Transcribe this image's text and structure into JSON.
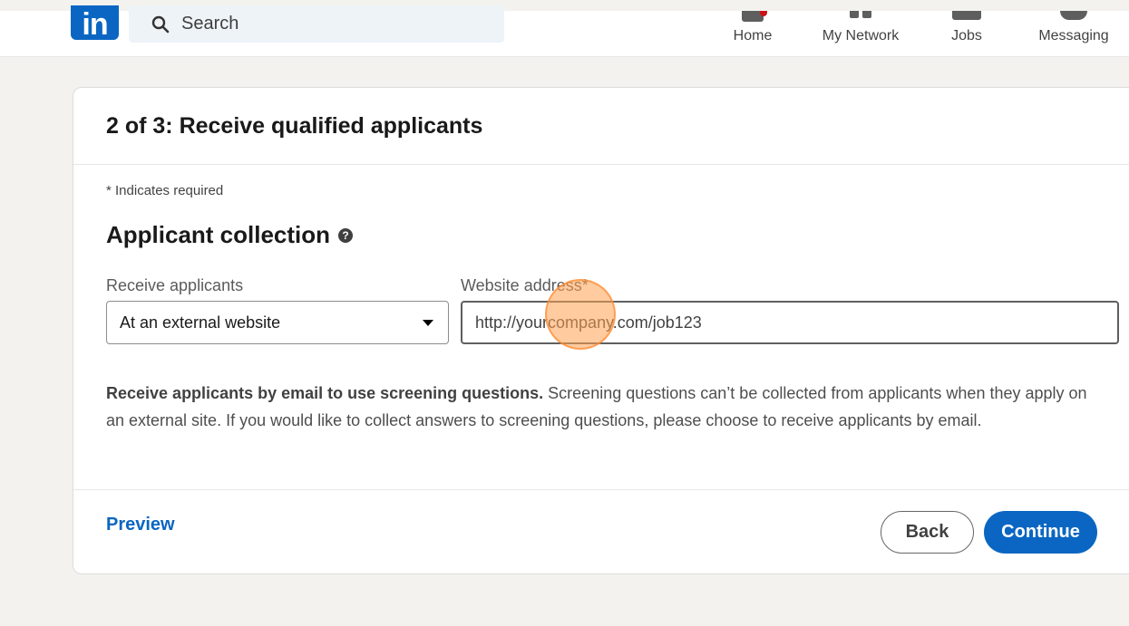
{
  "header": {
    "logo_text": "in",
    "search_placeholder": "Search",
    "nav": [
      {
        "label": "Home"
      },
      {
        "label": "My Network"
      },
      {
        "label": "Jobs"
      },
      {
        "label": "Messaging"
      }
    ]
  },
  "form": {
    "title": "2 of 3: Receive qualified applicants",
    "required_note": "* Indicates required",
    "section_title": "Applicant collection",
    "help_icon_glyph": "?",
    "receive_label": "Receive applicants",
    "receive_value": "At an external website",
    "website_label": "Website address*",
    "website_value": "http://yourcompany.com/job123",
    "info_bold": "Receive applicants by email to use screening questions.",
    "info_text": " Screening questions can’t be collected from applicants when they apply on an external site. If you would like to collect answers to screening questions, please choose to receive applicants by email."
  },
  "footer": {
    "preview_label": "Preview",
    "back_label": "Back",
    "continue_label": "Continue"
  },
  "colors": {
    "brand": "#0a66c2",
    "page_bg": "#f3f2ef",
    "click_highlight": "#ffa050"
  },
  "icons": [
    "linkedin-logo",
    "search-icon",
    "home-icon",
    "network-icon",
    "jobs-icon",
    "messaging-icon",
    "help-icon",
    "dropdown-caret-icon"
  ]
}
